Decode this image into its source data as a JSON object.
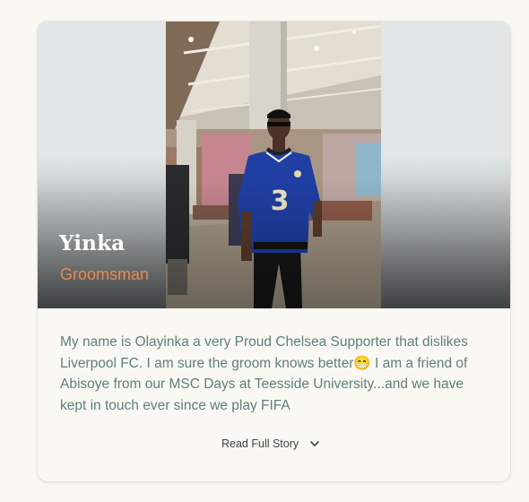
{
  "profile": {
    "name": "Yinka",
    "role": "Groomsman",
    "story": "My name is Olayinka a very Proud Chelsea Supporter that dislikes Liverpool FC. I am sure the groom knows better😁 I am a friend of Abisoye from our MSC Days at Teesside University...and we have kept in touch ever since we play FIFA",
    "read_more_label": "Read Full Story",
    "chevron_icon": "chevron-down-icon"
  },
  "colors": {
    "role": "#e98a4f",
    "story": "#5f7f7c",
    "background": "#faf8f3",
    "jersey": "#1f3fa3"
  }
}
